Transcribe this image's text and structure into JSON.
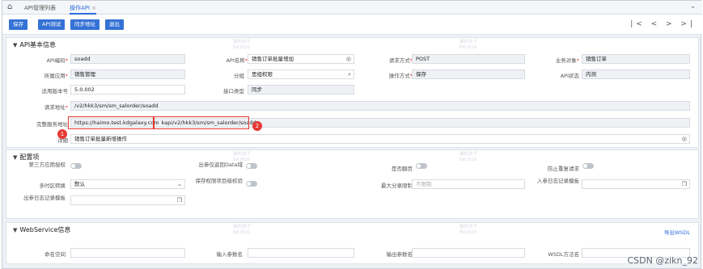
{
  "tabs": [
    {
      "label": "API管理列表"
    },
    {
      "label": "操作API"
    }
  ],
  "toolbar": {
    "buttons": [
      {
        "label": "保存"
      },
      {
        "label": "API测试"
      },
      {
        "label": "同步地址"
      },
      {
        "label": "退出"
      }
    ],
    "pager": "|< < > >|"
  },
  "basic": {
    "title": "API基本信息",
    "api_code_label": "API编码",
    "api_code_value": "soadd",
    "api_name_label": "API名称",
    "api_name_value": "销售订单批量增加",
    "request_method_label": "请求方式",
    "request_method_value": "POST",
    "business_object_label": "业务对象",
    "business_object_value": "销售订单",
    "app_label": "所属应用",
    "app_value": "销售管理",
    "group_label": "分组",
    "group_value": "思组权限",
    "op_mode_label": "操作方式",
    "op_mode_value": "保存",
    "api_status_label": "API状态",
    "api_status_value": "内测",
    "version_label": "适用版本号",
    "version_value": "5.0.002",
    "interface_type_label": "接口类型",
    "interface_type_value": "同步",
    "request_url_label": "请求地址",
    "request_url_value": "/v2/hkk3/sm/sm_salorder/soadd",
    "full_url_label": "完整服务地址",
    "full_url_host": "https://haimo.test.kdgalaxy.com",
    "full_url_path": "kapi/v2/hkk3/sm/sm_salorder/soadd",
    "detail_label": "详细",
    "detail_value": "销售订单批量新增操作"
  },
  "config": {
    "title": "配置项",
    "third_party_label": "第三方应用授权",
    "output_return_label": "出参仅返回Data域",
    "paging_label": "是否翻页",
    "anti_replay_label": "防止重复请求",
    "timezone_label": "多时区转换",
    "timezone_value": "默认",
    "save_verify_label": "保存权限项目级校验",
    "max_batch_label": "最大分录限制",
    "max_batch_placeholder": "不限制",
    "in_log_label": "入参日志记录模板",
    "out_log_label": "出参日志记录模板"
  },
  "webservice": {
    "title": "WebService信息",
    "export_label": "导出WSDL",
    "namespace_label": "命名空间",
    "in_param_label": "输入参数名",
    "out_param_label": "输出参数名",
    "wsdl_method_label": "WSDL方法名"
  },
  "annotations": [
    "1",
    "2"
  ],
  "watermark_text": "猫的孩子 BA1820",
  "footer_text": "CSDN @zikn_92"
}
